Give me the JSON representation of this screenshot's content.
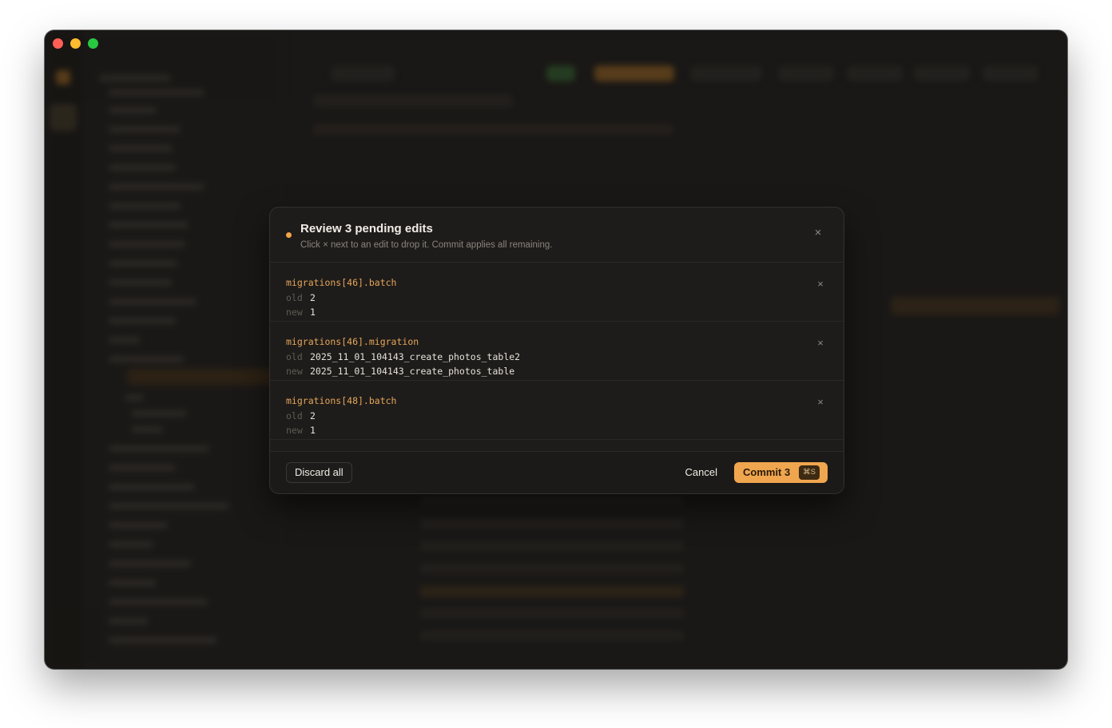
{
  "modal": {
    "title": "Review 3 pending edits",
    "subtitle": "Click × next to an edit to drop it. Commit applies all remaining.",
    "close_icon": "×",
    "edits": [
      {
        "path": "migrations[46].batch",
        "old_label": "old",
        "old_value": "2",
        "new_label": "new",
        "new_value": "1"
      },
      {
        "path": "migrations[46].migration",
        "old_label": "old",
        "old_value": "2025_11_01_104143_create_photos_table2",
        "new_label": "new",
        "new_value": "2025_11_01_104143_create_photos_table"
      },
      {
        "path": "migrations[48].batch",
        "old_label": "old",
        "old_value": "2",
        "new_label": "new",
        "new_value": "1"
      }
    ],
    "drop_icon": "×",
    "footer": {
      "discard_label": "Discard all",
      "cancel_label": "Cancel",
      "commit_label": "Commit 3",
      "commit_shortcut": "⌘S"
    }
  },
  "colors": {
    "accent": "#f0a64f",
    "path": "#e5a55a",
    "status_dot": "#f0a54a",
    "window_bg": "#1a1816"
  }
}
